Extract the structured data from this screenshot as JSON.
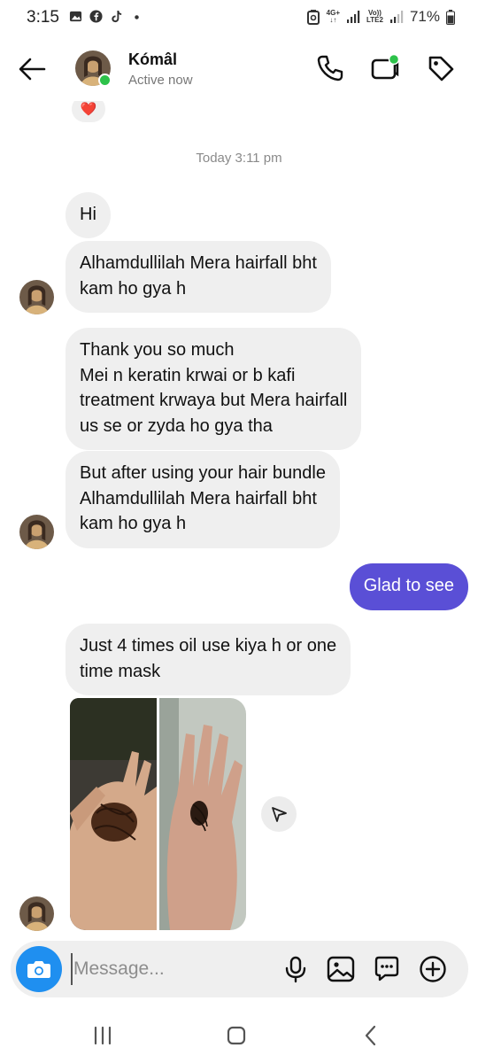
{
  "status_bar": {
    "time": "3:15",
    "network_top": "4G+",
    "volte_top": "Vo))",
    "volte_bottom": "LTE2",
    "battery": "71%"
  },
  "header": {
    "contact_name": "Kómâl",
    "status": "Active now",
    "icons": [
      "back-arrow-icon",
      "phone-icon",
      "video-call-icon",
      "tag-icon"
    ]
  },
  "chat": {
    "reaction": "❤️",
    "timestamp": "Today 3:11 pm",
    "messages": [
      {
        "direction": "in",
        "text": "Hi"
      },
      {
        "direction": "in",
        "text": "Alhamdullilah Mera hairfall bht\nkam ho gya h"
      },
      {
        "direction": "in",
        "text": "Thank you so much\nMei n keratin krwai or b kafi\ntreatment krwaya but Mera hairfall\nus se or zyda ho gya tha"
      },
      {
        "direction": "in",
        "text": "But after using your hair bundle\nAlhamdullilah Mera hairfall bht\nkam ho gya h"
      },
      {
        "direction": "out",
        "text": "Glad to see"
      },
      {
        "direction": "in",
        "text": "Just 4 times oil use kiya h or one\ntime mask"
      }
    ],
    "photos": [
      "hand-with-hair-photo",
      "hand-with-hair-photo"
    ]
  },
  "composer": {
    "placeholder": "Message...",
    "value": "",
    "icons": [
      "camera-icon",
      "microphone-icon",
      "gallery-icon",
      "sticker-icon",
      "plus-icon"
    ]
  },
  "navigation": [
    "recent-apps-icon",
    "home-icon",
    "back-icon"
  ],
  "colors": {
    "accent": "#5a4fd6",
    "incoming_bubble": "#efefef",
    "camera": "#1f8ff0",
    "online": "#2dc24a"
  }
}
